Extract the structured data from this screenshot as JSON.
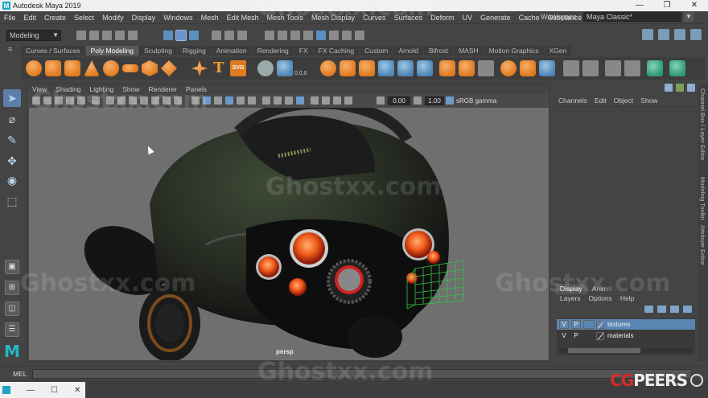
{
  "window": {
    "title": "Autodesk Maya 2019",
    "icon": "maya-icon",
    "controls": [
      "—",
      "❐",
      "✕"
    ]
  },
  "menubar": {
    "items": [
      "File",
      "Edit",
      "Create",
      "Select",
      "Modify",
      "Display",
      "Windows",
      "Mesh",
      "Edit Mesh",
      "Mesh Tools",
      "Mesh Display",
      "Curves",
      "Surfaces",
      "Deform",
      "UV",
      "Generate",
      "Cache",
      "Substance"
    ],
    "workspace_label": "Workspace :",
    "workspace_value": "Maya Classic*"
  },
  "statusline": {
    "mode": "Modeling"
  },
  "shelf": {
    "tabs": [
      "Curves / Surfaces",
      "Poly Modeling",
      "Sculpting",
      "Rigging",
      "Animation",
      "Rendering",
      "FX",
      "FX Caching",
      "Custom",
      "Arnold",
      "Bifrost",
      "MASH",
      "Motion Graphics",
      "XGen"
    ],
    "active_tab": "Poly Modeling",
    "svg_label": "SVG",
    "text_tool": "T",
    "number_label": "0,0,0"
  },
  "viewport_panel": {
    "menu": [
      "View",
      "Shading",
      "Lighting",
      "Show",
      "Renderer",
      "Panels"
    ],
    "field_a": "0.00",
    "field_b": "1.00",
    "gamma": "sRGB gamma",
    "camera": "persp"
  },
  "right_panel": {
    "tabs": [
      "Channels",
      "Edit",
      "Object",
      "Show"
    ],
    "layer_tabs": [
      "Display",
      "Anim"
    ],
    "active_layer_tab": "Display",
    "layer_menu": [
      "Layers",
      "Options",
      "Help"
    ],
    "layers": [
      {
        "v": "V",
        "p": "P",
        "name": "textures",
        "selected": true
      },
      {
        "v": "V",
        "p": "P",
        "name": "materials",
        "selected": false
      }
    ]
  },
  "side_tabs": [
    "Channel Box / Layer Editor",
    "Modeling Toolkit",
    "Attribute Editor"
  ],
  "bottom": {
    "mel_label": "MEL",
    "taskbar_controls": [
      "—",
      "☐",
      "✕"
    ]
  },
  "overlay": {
    "watermark": "Ghostxx.com",
    "cgpeers_cg": "CG",
    "cgpeers_peers": "PEERS"
  },
  "colors": {
    "accent": "#5b86b3",
    "maya_teal": "#1ba6c4",
    "shelf_orange": "#e07a1f",
    "cgpeers_red": "#d42b2b"
  }
}
